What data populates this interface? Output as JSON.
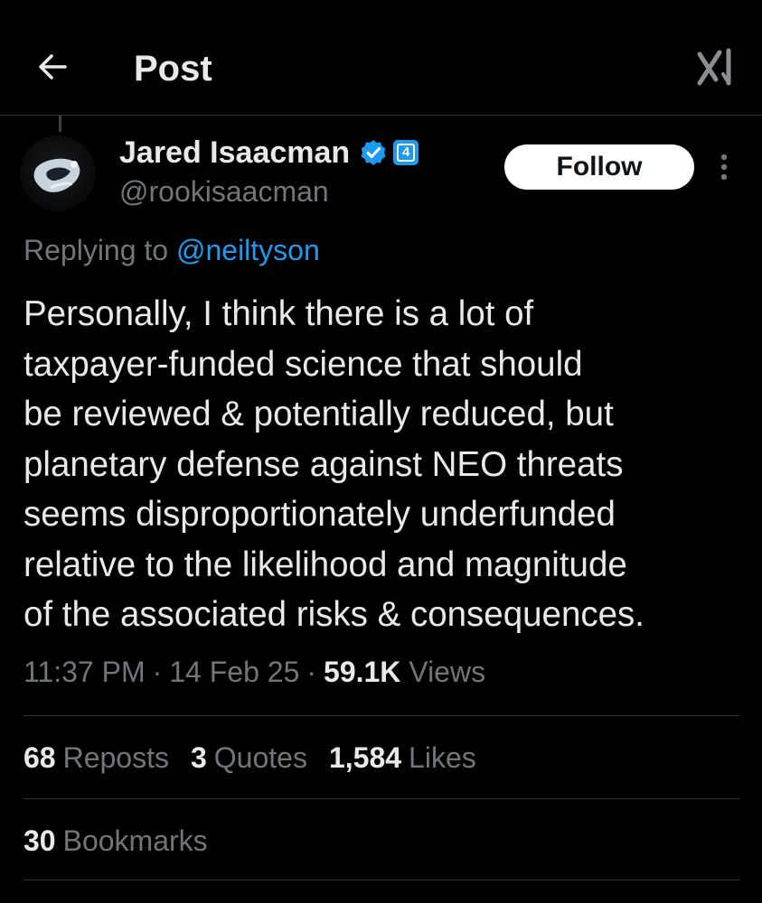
{
  "header": {
    "title": "Post",
    "back_icon": "arrow-left-icon",
    "grok_icon": "grok-icon"
  },
  "author": {
    "display_name": "Jared Isaacman",
    "handle": "@rookisaacman",
    "verified_icon": "verified-badge-icon",
    "affiliation_badge": "4"
  },
  "follow_label": "Follow",
  "reply": {
    "prefix": "Replying to",
    "mention": "@neiltyson"
  },
  "tweet": {
    "lines": [
      "Personally, I think there is a lot of",
      "taxpayer-funded science that should",
      "be reviewed & potentially reduced, but",
      "planetary defense against NEO threats",
      "seems disproportionately underfunded",
      "relative to the likelihood and magnitude",
      "of the associated risks & consequences."
    ]
  },
  "meta": {
    "time": "11:37 PM",
    "date": "14 Feb 25",
    "separator": "·",
    "views_count": "59.1K",
    "views_label": "Views"
  },
  "stats": {
    "reposts_count": "68",
    "reposts_label": "Reposts",
    "quotes_count": "3",
    "quotes_label": "Quotes",
    "likes_count": "1,584",
    "likes_label": "Likes",
    "bookmarks_count": "30",
    "bookmarks_label": "Bookmarks"
  },
  "colors": {
    "background": "#000000",
    "text": "#e7e9ea",
    "secondary": "#71767b",
    "accent": "#1d9bf0",
    "divider": "#2f3336"
  }
}
